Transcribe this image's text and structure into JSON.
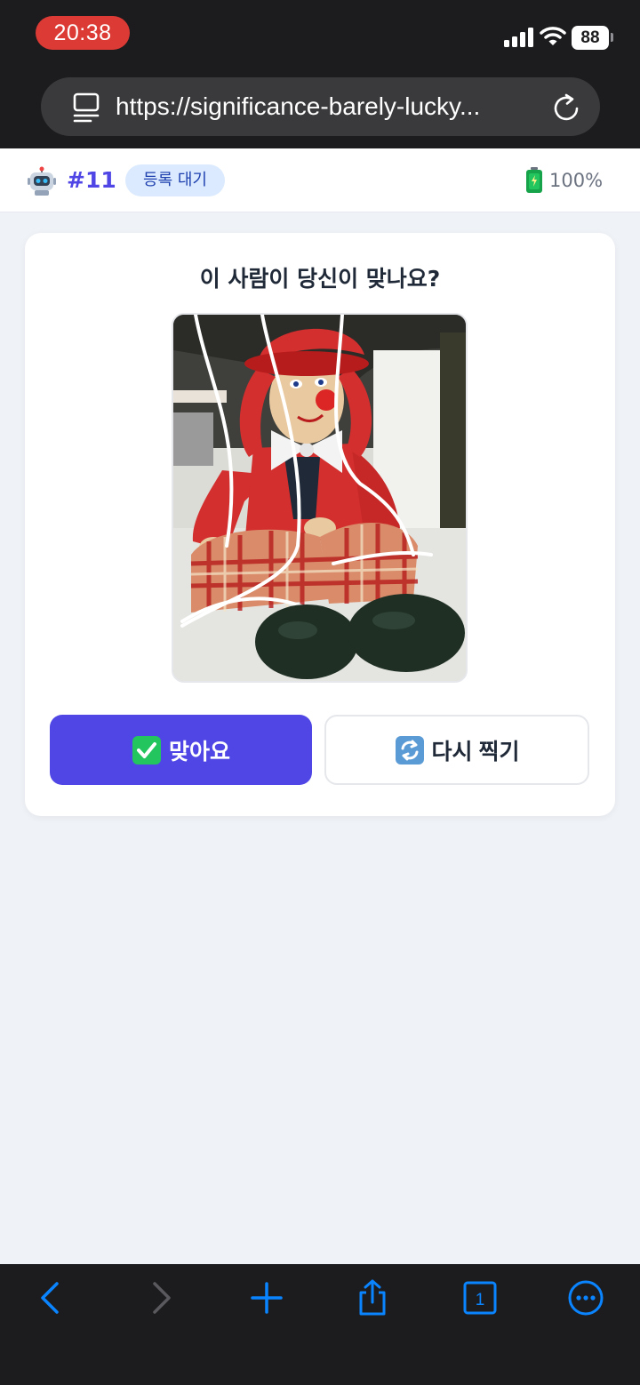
{
  "status_bar": {
    "time": "20:38",
    "battery": "88"
  },
  "browser": {
    "url": "https://significance-barely-lucky...",
    "tab_count": "1"
  },
  "header": {
    "agent_icon": "robot-icon",
    "agent_number": "#11",
    "status_badge": "등록 대기",
    "battery_icon": "battery-icon",
    "battery_level": "100%"
  },
  "card": {
    "question": "이 사람이 당신이 맞나요?",
    "photo_description": "clown-doll-photo",
    "confirm_label": "맞아요",
    "confirm_icon": "check-mark-icon",
    "retake_label": "다시 찍기",
    "retake_icon": "repeat-arrows-icon"
  },
  "toolbar": {
    "icons": [
      "back-icon",
      "forward-icon",
      "new-tab-icon",
      "share-icon",
      "tabs-icon",
      "more-icon"
    ]
  },
  "colors": {
    "accent": "#4f46e5",
    "badge_bg": "#dbeafe",
    "badge_text": "#1e40af",
    "page_bg": "#eff2f7",
    "ios_blue": "#0a84ff",
    "time_pill": "#dc3a35"
  }
}
